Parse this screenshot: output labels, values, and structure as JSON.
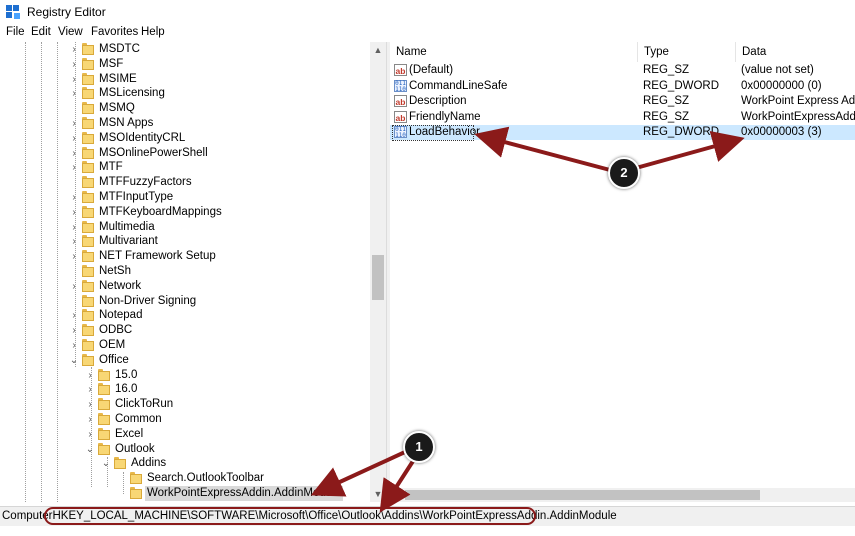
{
  "window": {
    "title": "Registry Editor"
  },
  "menu": [
    "File",
    "Edit",
    "View",
    "Favorites",
    "Help"
  ],
  "tree": [
    {
      "label": "MSDTC",
      "chev": "›"
    },
    {
      "label": "MSF",
      "chev": "›"
    },
    {
      "label": "MSIME",
      "chev": "›"
    },
    {
      "label": "MSLicensing",
      "chev": "›"
    },
    {
      "label": "MSMQ",
      "chev": ""
    },
    {
      "label": "MSN Apps",
      "chev": "›"
    },
    {
      "label": "MSOIdentityCRL",
      "chev": "›"
    },
    {
      "label": "MSOnlinePowerShell",
      "chev": "›"
    },
    {
      "label": "MTF",
      "chev": "›"
    },
    {
      "label": "MTFFuzzyFactors",
      "chev": ""
    },
    {
      "label": "MTFInputType",
      "chev": "›"
    },
    {
      "label": "MTFKeyboardMappings",
      "chev": "›"
    },
    {
      "label": "Multimedia",
      "chev": "›"
    },
    {
      "label": "Multivariant",
      "chev": "›"
    },
    {
      "label": "NET Framework Setup",
      "chev": "›"
    },
    {
      "label": "NetSh",
      "chev": ""
    },
    {
      "label": "Network",
      "chev": "›"
    },
    {
      "label": "Non-Driver Signing",
      "chev": ""
    },
    {
      "label": "Notepad",
      "chev": "›"
    },
    {
      "label": "ODBC",
      "chev": "›"
    },
    {
      "label": "OEM",
      "chev": "›"
    },
    {
      "label": "Office",
      "chev": "⌄"
    },
    {
      "label": "15.0",
      "chev": "›"
    },
    {
      "label": "16.0",
      "chev": "›"
    },
    {
      "label": "ClickToRun",
      "chev": "›"
    },
    {
      "label": "Common",
      "chev": "›"
    },
    {
      "label": "Excel",
      "chev": "›"
    },
    {
      "label": "Outlook",
      "chev": "⌄"
    },
    {
      "label": "Addins",
      "chev": "⌄"
    },
    {
      "label": "Search.OutlookToolbar",
      "chev": ""
    },
    {
      "label": "WorkPointExpressAddin.AddinModule",
      "chev": ""
    }
  ],
  "columns": {
    "name": "Name",
    "type": "Type",
    "data": "Data"
  },
  "values": [
    {
      "icon": "ab",
      "name": "(Default)",
      "type": "REG_SZ",
      "data": "(value not set)"
    },
    {
      "icon": "bin",
      "name": "CommandLineSafe",
      "type": "REG_DWORD",
      "data": "0x00000000 (0)"
    },
    {
      "icon": "ab",
      "name": "Description",
      "type": "REG_SZ",
      "data": "WorkPoint Express Addin"
    },
    {
      "icon": "ab",
      "name": "FriendlyName",
      "type": "REG_SZ",
      "data": "WorkPointExpressAddin"
    },
    {
      "icon": "bin",
      "name": "LoadBehavior",
      "type": "REG_DWORD",
      "data": "0x00000003 (3)"
    }
  ],
  "selected_value": "LoadBehavior",
  "selected_key": "WorkPointExpressAddin.AddinModule",
  "status": {
    "prefix": "Computer",
    "path": "HKEY_LOCAL_MACHINE\\SOFTWARE\\Microsoft\\Office\\Outlook\\Addins\\WorkPointExpressAddin.AddinModule"
  },
  "annotations": {
    "badge1": "1",
    "badge2": "2",
    "arrow_color": "#8b1a1a",
    "highlight_color": "#8b1a1a"
  }
}
